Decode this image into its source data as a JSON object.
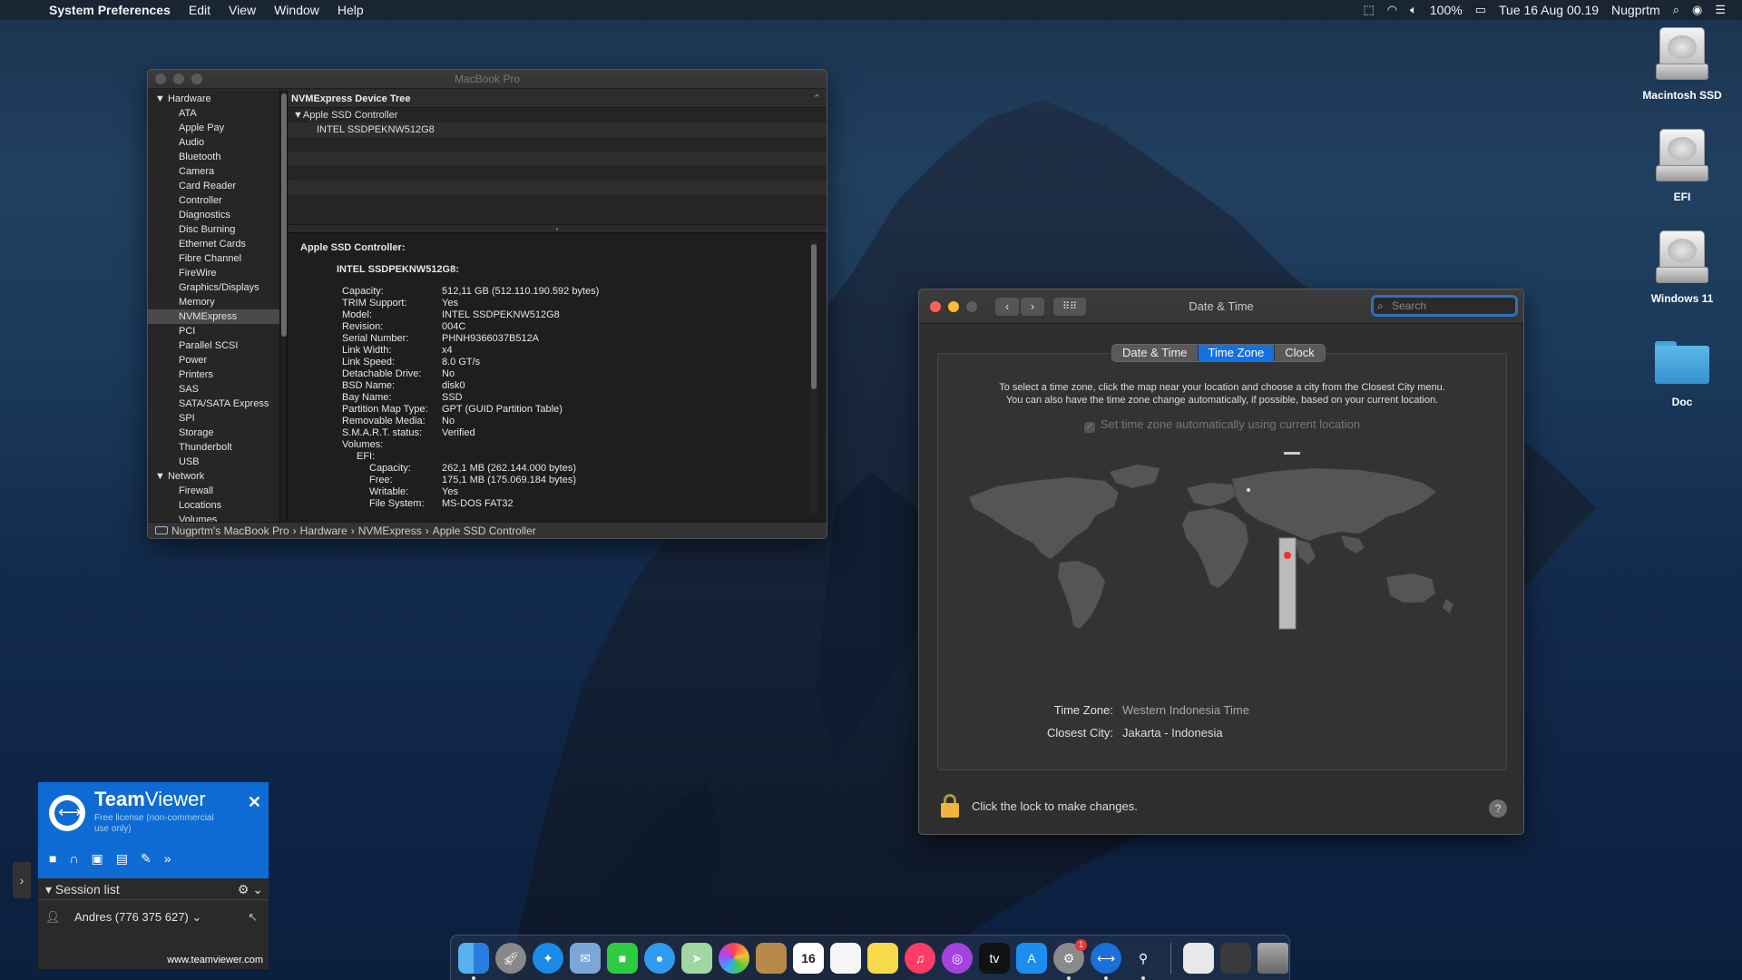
{
  "menubar": {
    "app": "System Preferences",
    "items": [
      "Edit",
      "View",
      "Window",
      "Help"
    ],
    "battery": "100%",
    "datetime": "Tue 16 Aug  00.19",
    "user": "Nugprtm"
  },
  "desktop": {
    "icons": [
      {
        "label": "Macintosh SSD",
        "icon": "hard-drive-icon"
      },
      {
        "label": "EFI",
        "icon": "hard-drive-icon"
      },
      {
        "label": "Windows 11",
        "icon": "hard-drive-icon"
      },
      {
        "label": "Doc",
        "icon": "folder-icon"
      }
    ]
  },
  "sysinfo": {
    "title": "MacBook Pro",
    "sidebar": {
      "hardware_label": "Hardware",
      "hardware_items": [
        "ATA",
        "Apple Pay",
        "Audio",
        "Bluetooth",
        "Camera",
        "Card Reader",
        "Controller",
        "Diagnostics",
        "Disc Burning",
        "Ethernet Cards",
        "Fibre Channel",
        "FireWire",
        "Graphics/Displays",
        "Memory",
        "NVMExpress",
        "PCI",
        "Parallel SCSI",
        "Power",
        "Printers",
        "SAS",
        "SATA/SATA Express",
        "SPI",
        "Storage",
        "Thunderbolt",
        "USB"
      ],
      "selected": "NVMExpress",
      "network_label": "Network",
      "network_items": [
        "Firewall",
        "Locations",
        "Volumes"
      ]
    },
    "tree": {
      "header": "NVMExpress Device Tree",
      "controller": "Apple SSD Controller",
      "device": "INTEL SSDPEKNW512G8"
    },
    "detail": {
      "heading": "Apple SSD Controller:",
      "device": "INTEL SSDPEKNW512G8:",
      "props": [
        [
          "Capacity:",
          "512,11 GB (512.110.190.592 bytes)"
        ],
        [
          "TRIM Support:",
          "Yes"
        ],
        [
          "Model:",
          "INTEL SSDPEKNW512G8"
        ],
        [
          "Revision:",
          "004C"
        ],
        [
          "Serial Number:",
          "PHNH9366037B512A"
        ],
        [
          "Link Width:",
          "x4"
        ],
        [
          "Link Speed:",
          "8.0 GT/s"
        ],
        [
          "Detachable Drive:",
          "No"
        ],
        [
          "BSD Name:",
          "disk0"
        ],
        [
          "Bay Name:",
          "SSD"
        ],
        [
          "Partition Map Type:",
          "GPT (GUID Partition Table)"
        ],
        [
          "Removable Media:",
          "No"
        ],
        [
          "S.M.A.R.T. status:",
          "Verified"
        ],
        [
          "Volumes:",
          ""
        ]
      ],
      "volume_name": "EFI:",
      "volume_props": [
        [
          "Capacity:",
          "262,1 MB (262.144.000 bytes)"
        ],
        [
          "Free:",
          "175,1 MB (175.069.184 bytes)"
        ],
        [
          "Writable:",
          "Yes"
        ],
        [
          "File System:",
          "MS-DOS FAT32"
        ]
      ]
    },
    "path": [
      "Nugprtm's MacBook Pro",
      "Hardware",
      "NVMExpress",
      "Apple SSD Controller"
    ]
  },
  "datetime": {
    "title": "Date & Time",
    "search_placeholder": "Search",
    "tabs": [
      "Date & Time",
      "Time Zone",
      "Clock"
    ],
    "active_tab": "Time Zone",
    "info_line1": "To select a time zone, click the map near your location and choose a city from the Closest City menu.",
    "info_line2": "You can also have the time zone change automatically, if possible, based on your current location.",
    "auto_label": "Set time zone automatically using current location",
    "tz_label": "Time Zone:",
    "tz_value": "Western Indonesia Time",
    "city_label": "Closest City:",
    "city_value": "Jakarta - Indonesia",
    "lock_text": "Click the lock to make changes.",
    "help": "?"
  },
  "teamviewer": {
    "brand_bold": "Team",
    "brand_rest": "Viewer",
    "license": "Free license (non-commercial use only)",
    "session_list": "Session list",
    "contact": "Andres (776 375 627)",
    "url": "www.teamviewer.com"
  },
  "dock": {
    "calendar_day": "16"
  }
}
